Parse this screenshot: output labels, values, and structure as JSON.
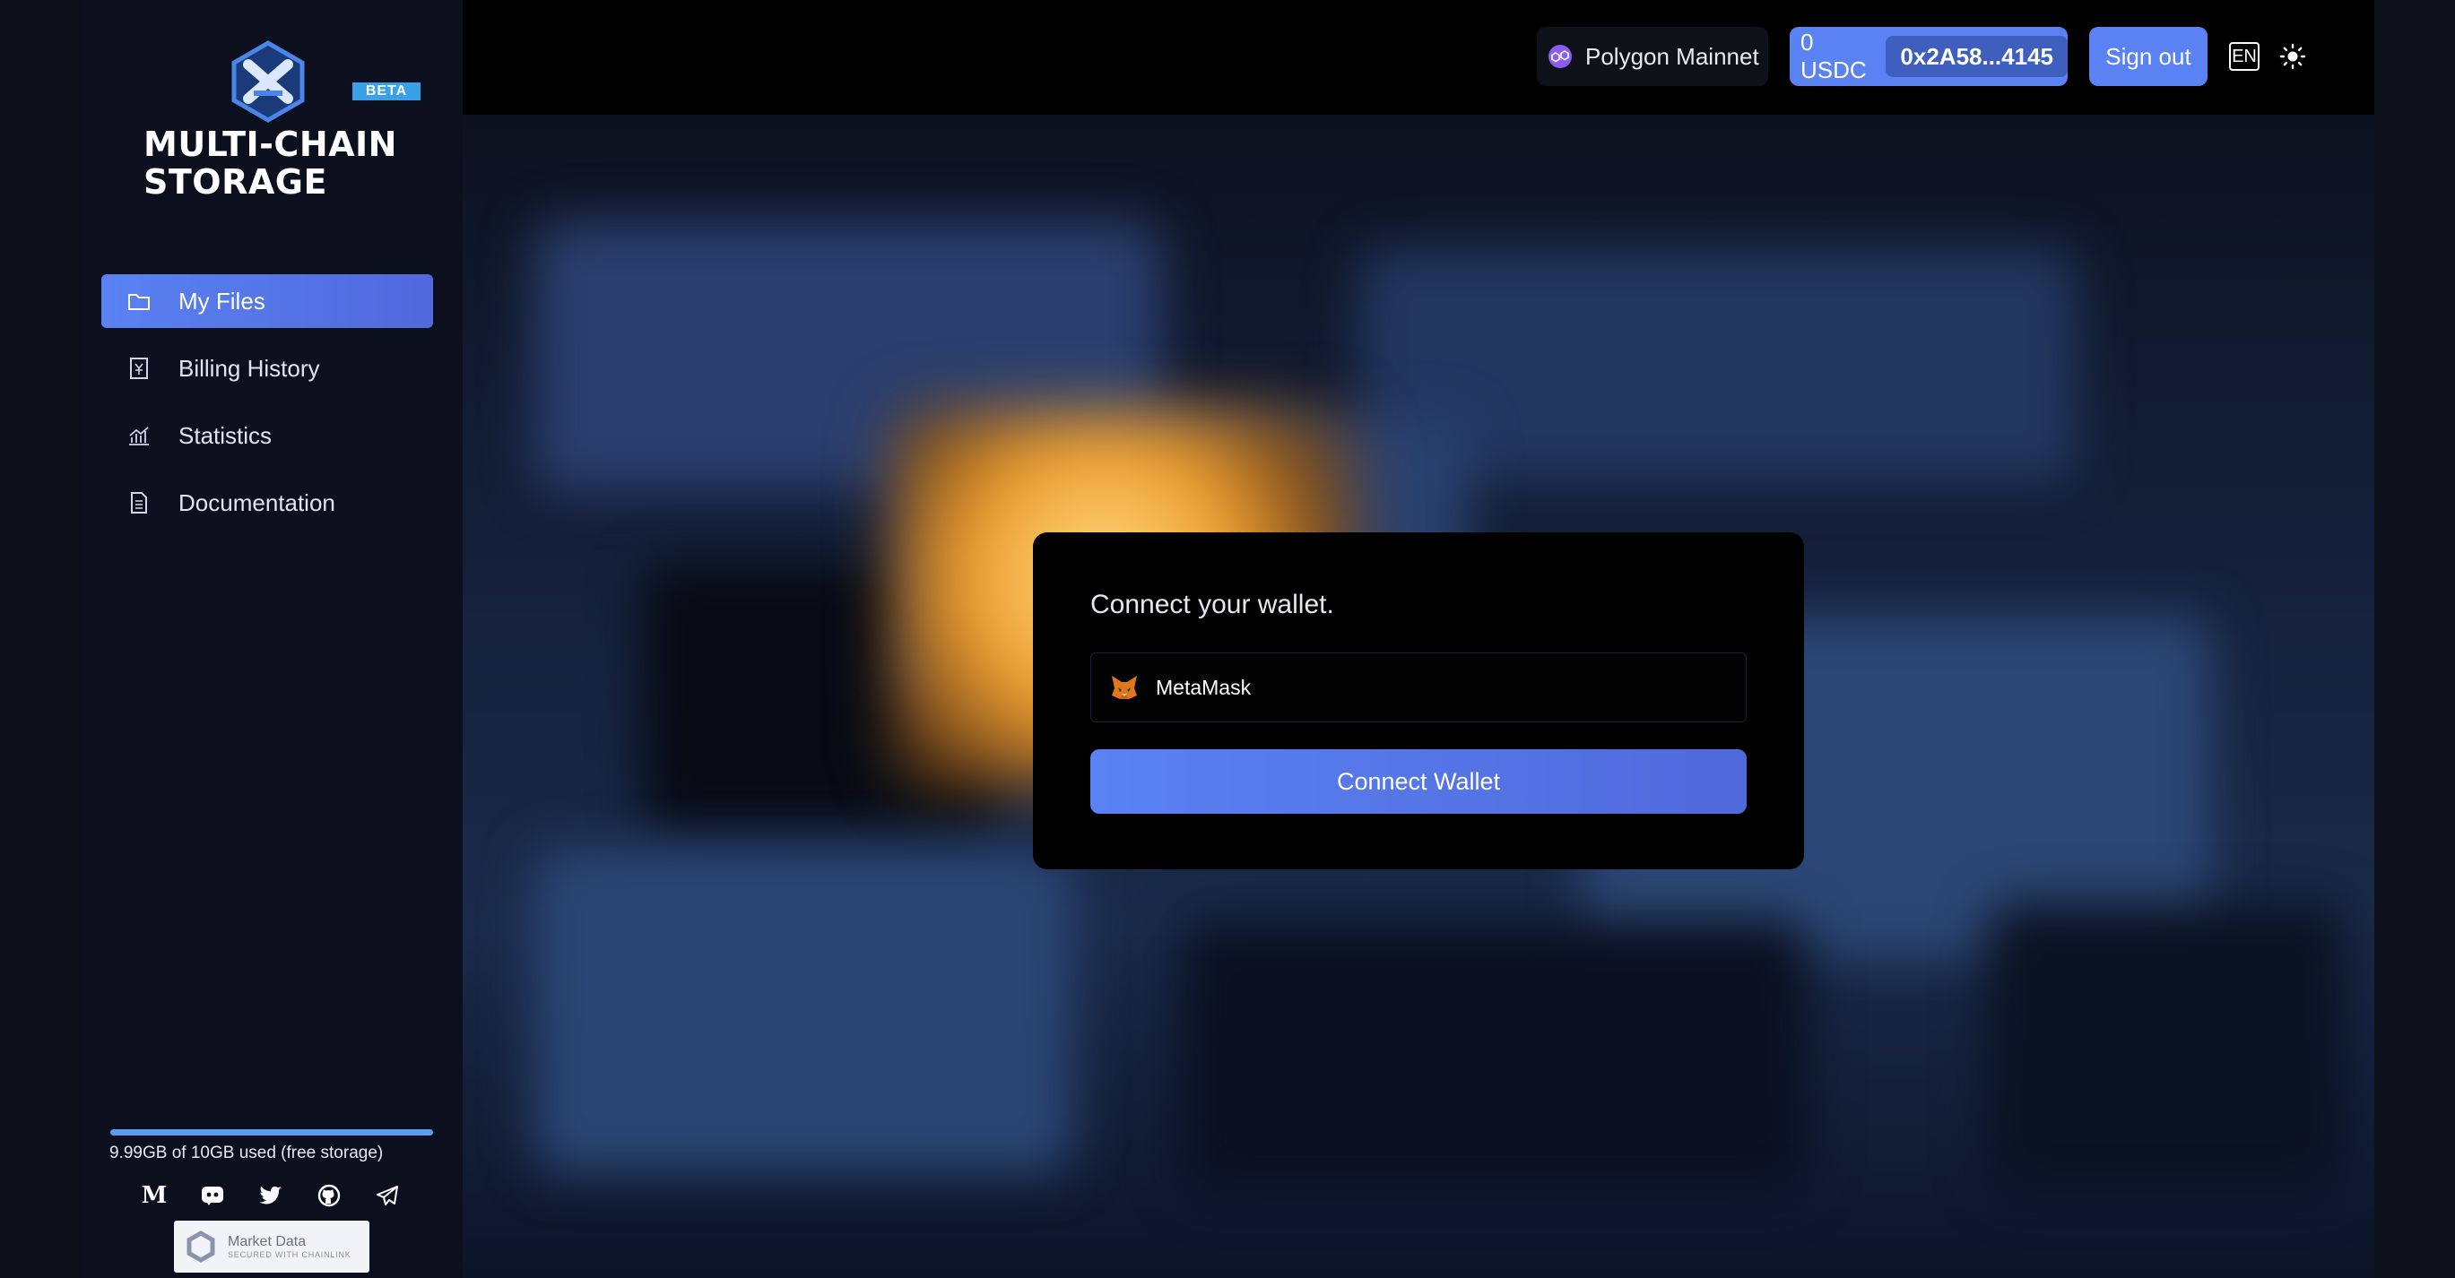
{
  "app": {
    "logo_badge": "BETA",
    "logo_title_line1": "MULTI-CHAIN",
    "logo_title_line2": "STORAGE"
  },
  "sidebar": {
    "items": [
      {
        "label": "My Files",
        "icon": "folder-icon",
        "active": true
      },
      {
        "label": "Billing History",
        "icon": "receipt-icon",
        "active": false
      },
      {
        "label": "Statistics",
        "icon": "chart-icon",
        "active": false
      },
      {
        "label": "Documentation",
        "icon": "document-icon",
        "active": false
      }
    ],
    "storage_usage_text": "9.99GB of 10GB used (free storage)",
    "storage_used_fraction": 1.0,
    "socials": [
      "medium-icon",
      "discord-icon",
      "twitter-icon",
      "github-icon",
      "telegram-icon"
    ],
    "badge_line1": "Market Data",
    "badge_line2": "SECURED WITH CHAINLINK"
  },
  "header": {
    "network": "Polygon Mainnet",
    "balance": "0 USDC",
    "address": "0x2A58...4145",
    "sign_out": "Sign out",
    "language": "EN"
  },
  "modal": {
    "title": "Connect your wallet.",
    "option_label": "MetaMask",
    "connect_button": "Connect Wallet"
  },
  "colors": {
    "accent": "#5a82f2",
    "sidebar_bg": "#0b0f1e",
    "header_bg": "#000000",
    "beta_badge": "#3aa0e8"
  }
}
